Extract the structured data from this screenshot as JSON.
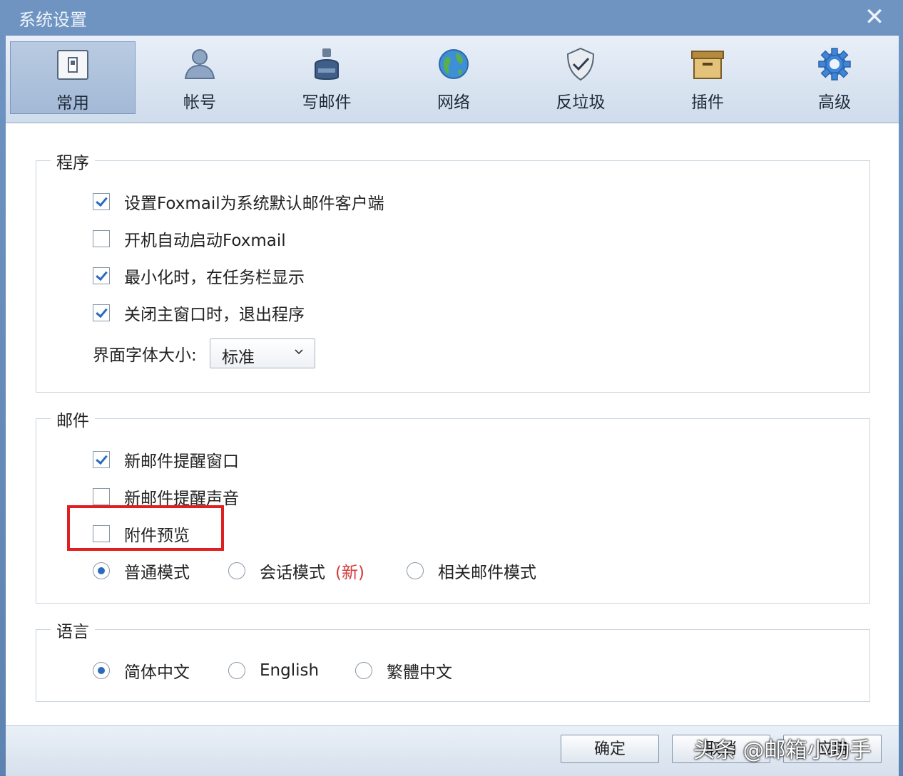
{
  "window": {
    "title": "系统设置",
    "close": "✕"
  },
  "tabs": [
    {
      "label": "常用",
      "icon": "device-icon"
    },
    {
      "label": "帐号",
      "icon": "user-icon"
    },
    {
      "label": "写邮件",
      "icon": "inkwell-icon"
    },
    {
      "label": "网络",
      "icon": "globe-icon"
    },
    {
      "label": "反垃圾",
      "icon": "shield-check-icon"
    },
    {
      "label": "插件",
      "icon": "box-icon"
    },
    {
      "label": "高级",
      "icon": "gear-icon"
    }
  ],
  "active_tab": "常用",
  "program": {
    "legend": "程序",
    "options": [
      {
        "label": "设置Foxmail为系统默认邮件客户端",
        "checked": true
      },
      {
        "label": "开机自动启动Foxmail",
        "checked": false
      },
      {
        "label": "最小化时，在任务栏显示",
        "checked": true
      },
      {
        "label": "关闭主窗口时，退出程序",
        "checked": true
      }
    ],
    "font_size_label": "界面字体大小:",
    "font_size_value": "标准"
  },
  "mail": {
    "legend": "邮件",
    "options": [
      {
        "label": "新邮件提醒窗口",
        "checked": true
      },
      {
        "label": "新邮件提醒声音",
        "checked": false
      },
      {
        "label": "附件预览",
        "checked": false
      }
    ],
    "modes": [
      {
        "label": "普通模式",
        "selected": true
      },
      {
        "label": "会话模式",
        "badge": "(新)",
        "selected": false
      },
      {
        "label": "相关邮件模式",
        "selected": false
      }
    ]
  },
  "language": {
    "legend": "语言",
    "options": [
      {
        "label": "简体中文",
        "selected": true
      },
      {
        "label": "English",
        "selected": false
      },
      {
        "label": "繁體中文",
        "selected": false
      }
    ]
  },
  "footer": {
    "ok": "确定",
    "cancel": "取消",
    "apply": "应用"
  },
  "watermark": "头条 @邮箱小助手",
  "colors": {
    "accent": "#2a6bbf",
    "highlight": "#e02020",
    "titlebar": "#6f94c2"
  }
}
